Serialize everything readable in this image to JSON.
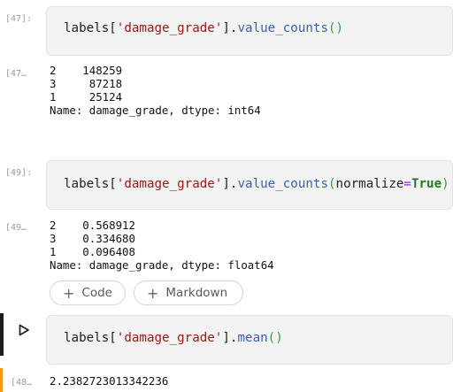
{
  "cells": [
    {
      "prompt": "[47]:",
      "code": {
        "obj": "labels[",
        "key": "'damage_grade'",
        "close": "].",
        "method": "value_counts",
        "open_paren": "(",
        "args_kw": "",
        "args_eq": "",
        "args_val": "",
        "close_paren": ")"
      },
      "out_prompt": "[47…",
      "output": "2    148259\n3     87218\n1     25124\nName: damage_grade, dtype: int64"
    },
    {
      "prompt": "[49]:",
      "code": {
        "obj": "labels[",
        "key": "'damage_grade'",
        "close": "].",
        "method": "value_counts",
        "open_paren": "(",
        "args_kw": "normalize",
        "args_eq": "=",
        "args_val": "True",
        "close_paren": ")"
      },
      "out_prompt": "[49…",
      "output": "2    0.568912\n3    0.334680\n1    0.096408\nName: damage_grade, dtype: float64"
    },
    {
      "prompt": "",
      "code": {
        "obj": "labels[",
        "key": "'damage_grade'",
        "close": "].",
        "method": "mean",
        "open_paren": "(",
        "args_kw": "",
        "args_eq": "",
        "args_val": "",
        "close_paren": ")"
      },
      "out_prompt": "[48…",
      "output": "2.2382723013342236"
    }
  ],
  "add_buttons": {
    "code_label": "Code",
    "markdown_label": "Markdown"
  },
  "colors": {
    "string": "#a31515",
    "method": "#3a5fad",
    "paren": "#2f9e44",
    "keyword": "#1e7a1e",
    "operator": "#8a2be2",
    "running_marker": "#f39c12"
  },
  "icons": {
    "run": "play-outline-icon",
    "add": "plus-icon"
  }
}
